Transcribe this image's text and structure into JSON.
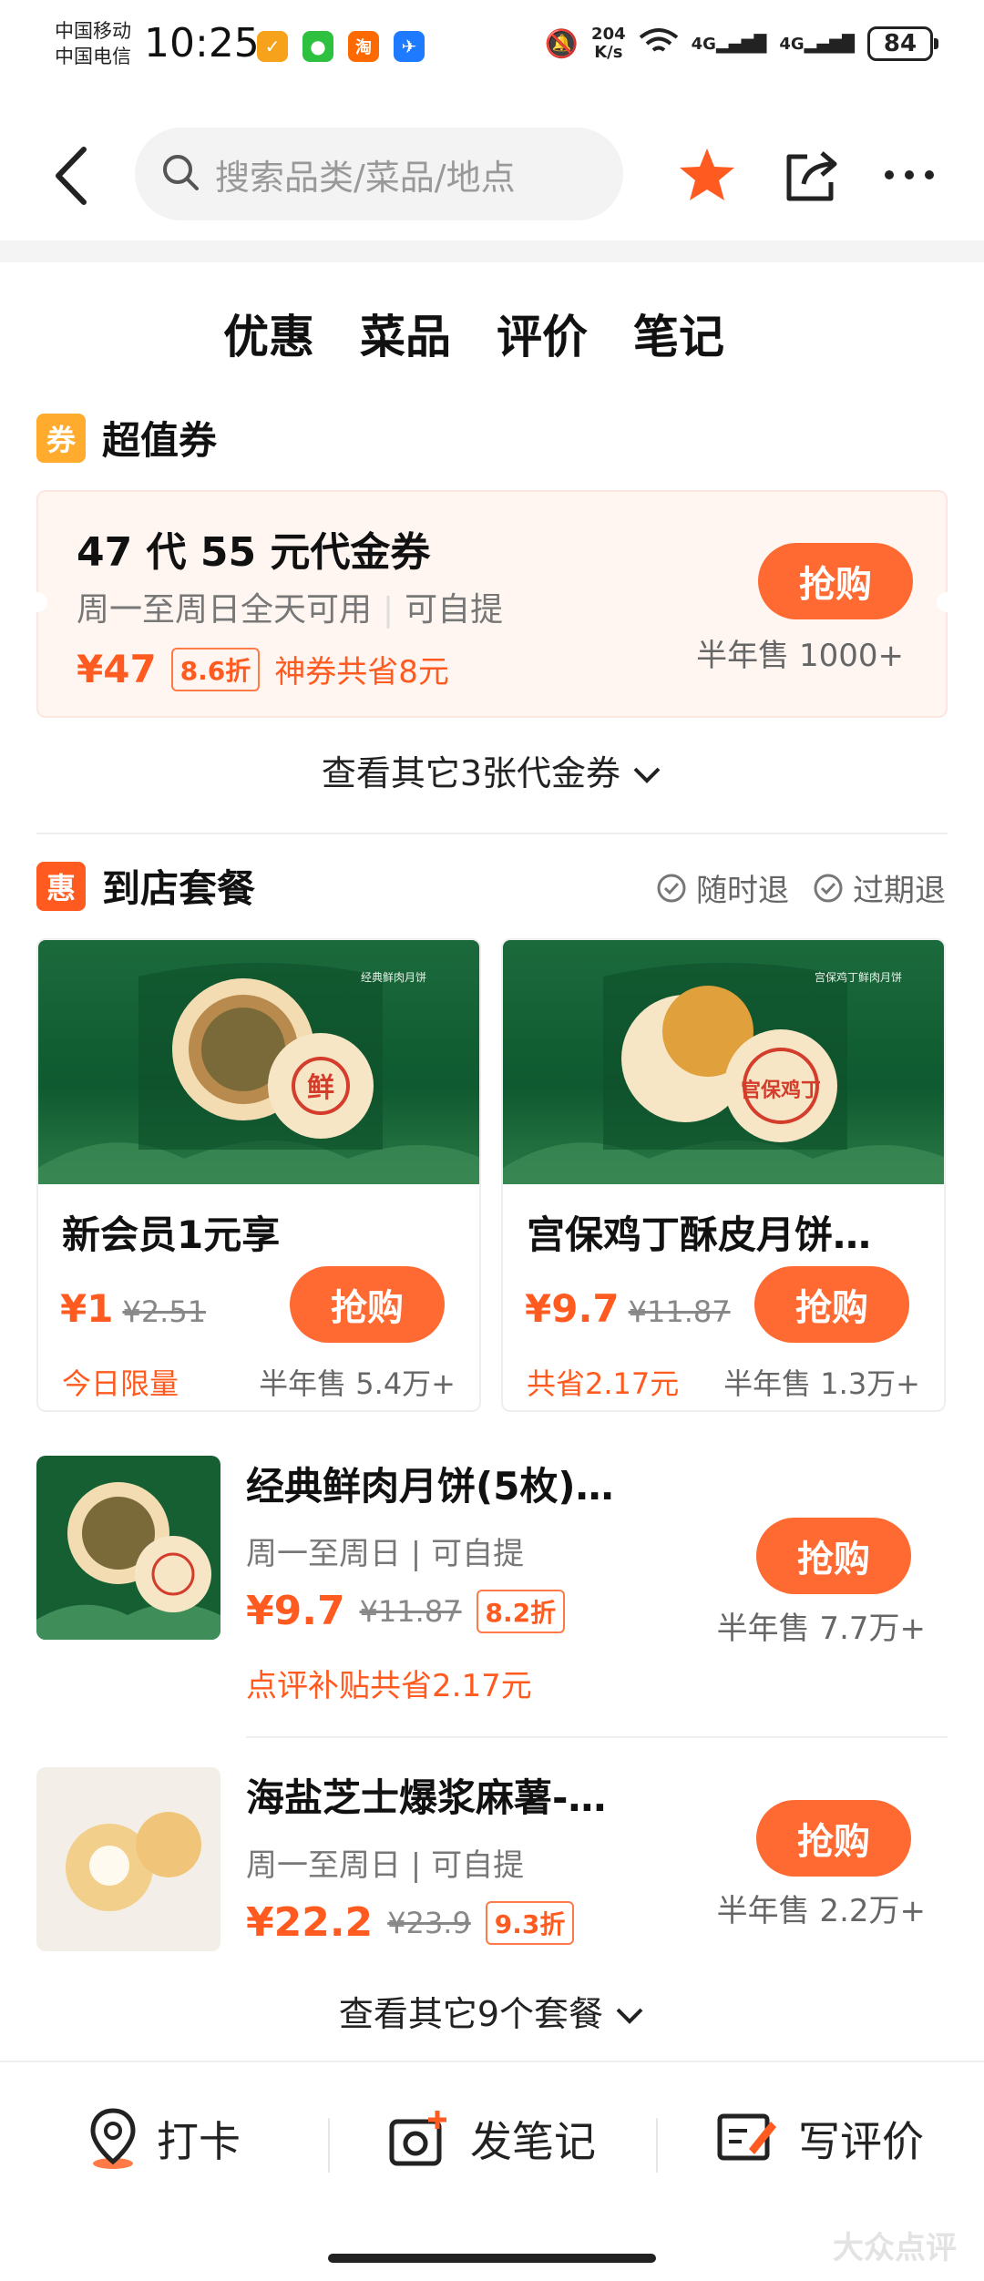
{
  "status_bar": {
    "carrier_1": "中国移动",
    "carrier_2": "中国电信",
    "time": "10:25",
    "speed_value": "204",
    "speed_unit": "K/s",
    "net_1": "4G",
    "net_2": "4G",
    "battery": "84",
    "app_icons": [
      "taobao-lite-icon",
      "wechat-icon",
      "taobao-icon",
      "flight-icon"
    ]
  },
  "nav": {
    "search_placeholder": "搜索品类/菜品/地点"
  },
  "tabs": [
    "优惠",
    "菜品",
    "评价",
    "笔记"
  ],
  "voucher_section": {
    "badge": "券",
    "title": "超值券",
    "voucher": {
      "title": "47 代 55 元代金券",
      "sub_1": "周一至周日全天可用",
      "sub_2": "可自提",
      "price": "¥47",
      "discount": "8.6折",
      "saving": "神券共省8元",
      "button": "抢购",
      "sold": "半年售 1000+"
    },
    "more": "查看其它3张代金券"
  },
  "package_section": {
    "badge": "惠",
    "title": "到店套餐",
    "policies": [
      "随时退",
      "过期退"
    ],
    "cards": [
      {
        "title": "新会员1元享",
        "price": "¥1",
        "original": "¥2.51",
        "button": "抢购",
        "foot_left": "今日限量",
        "foot_right": "半年售 5.4万+",
        "image_text": "经典鲜肉月饼",
        "stamp": "鲜"
      },
      {
        "title": "宫保鸡丁酥皮月饼…",
        "price": "¥9.7",
        "original": "¥11.87",
        "button": "抢购",
        "foot_left": "共省2.17元",
        "foot_right": "半年售 1.3万+",
        "image_text": "宫保鸡丁鲜肉月饼",
        "stamp": "宫保鸡丁"
      }
    ],
    "items": [
      {
        "title": "经典鲜肉月饼(5枚)…",
        "sub": "周一至周日 | 可自提",
        "price": "¥9.7",
        "original": "¥11.87",
        "discount": "8.2折",
        "extra": "点评补贴共省2.17元",
        "button": "抢购",
        "sold": "半年售 7.7万+"
      },
      {
        "title": "海盐芝士爆浆麻薯-…",
        "sub": "周一至周日 | 可自提",
        "price": "¥22.2",
        "original": "¥23.9",
        "discount": "9.3折",
        "button": "抢购",
        "sold": "半年售 2.2万+"
      }
    ],
    "more": "查看其它9个套餐"
  },
  "bottom_bar": {
    "checkin": "打卡",
    "post_note": "发笔记",
    "write_review": "写评价"
  },
  "watermark": "大众点评",
  "colors": {
    "accent": "#ff5a1f",
    "button": "#ff6a33",
    "voucher_bg": "#fff6f2",
    "card_green": "#1b6a3c"
  }
}
